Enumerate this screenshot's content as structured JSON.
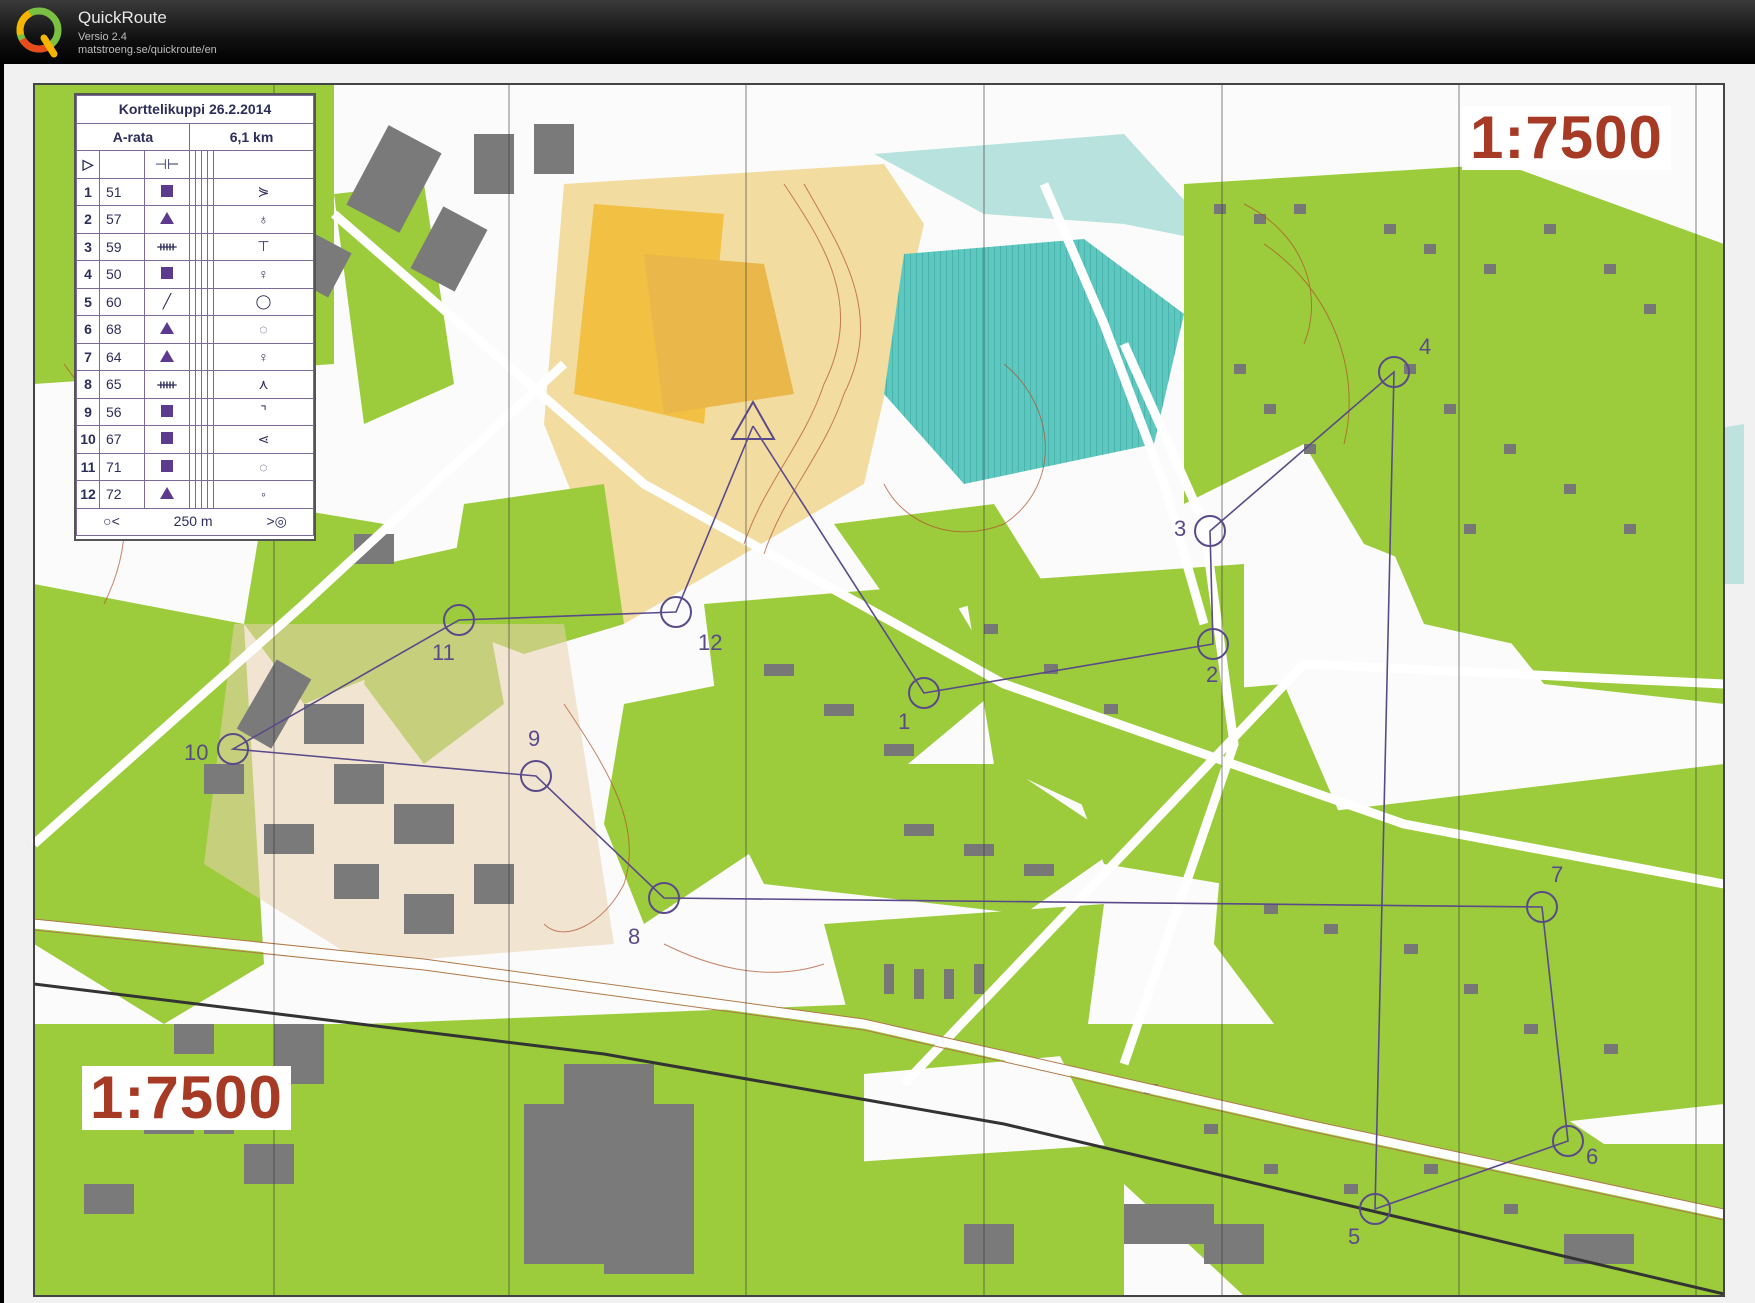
{
  "app": {
    "title": "QuickRoute",
    "version": "Versio 2.4",
    "url": "matstroeng.se/quickroute/en"
  },
  "map": {
    "scale_top": "1:7500",
    "scale_bottom": "1:7500",
    "colors": {
      "vegetation": "#9ccc3c",
      "water": "#3ab8b0",
      "buildings": "#7a7a7a",
      "open_land": "#f6d98a",
      "course": "#5a4a8a",
      "contours": "#b0502c"
    },
    "legend": {
      "title": "Korttelikuppi 26.2.2014",
      "course": "A-rata",
      "length": "6,1 km",
      "start_symbol": "▷",
      "start_feature": "⊣⊢",
      "finish_distance": "250 m",
      "controls": [
        {
          "n": "1",
          "code": "51",
          "feature": "square",
          "detail": "⋟"
        },
        {
          "n": "2",
          "code": "57",
          "feature": "triangle",
          "detail": "♁"
        },
        {
          "n": "3",
          "code": "59",
          "feature": "cliff",
          "detail": "⊤"
        },
        {
          "n": "4",
          "code": "50",
          "feature": "square",
          "detail": "♀"
        },
        {
          "n": "5",
          "code": "60",
          "feature": "line",
          "detail": "◯"
        },
        {
          "n": "6",
          "code": "68",
          "feature": "triangle",
          "detail": "◌"
        },
        {
          "n": "7",
          "code": "64",
          "feature": "triangle",
          "detail": "♀"
        },
        {
          "n": "8",
          "code": "65",
          "feature": "cliff",
          "detail": "⋏"
        },
        {
          "n": "9",
          "code": "56",
          "feature": "square",
          "detail": "⌝"
        },
        {
          "n": "10",
          "code": "67",
          "feature": "square",
          "detail": "⋖"
        },
        {
          "n": "11",
          "code": "71",
          "feature": "square",
          "detail": "◌"
        },
        {
          "n": "12",
          "code": "72",
          "feature": "triangle",
          "detail": "◦"
        }
      ]
    },
    "control_labels": [
      "1",
      "2",
      "3",
      "4",
      "5",
      "6",
      "7",
      "8",
      "9",
      "10",
      "11",
      "12"
    ]
  }
}
